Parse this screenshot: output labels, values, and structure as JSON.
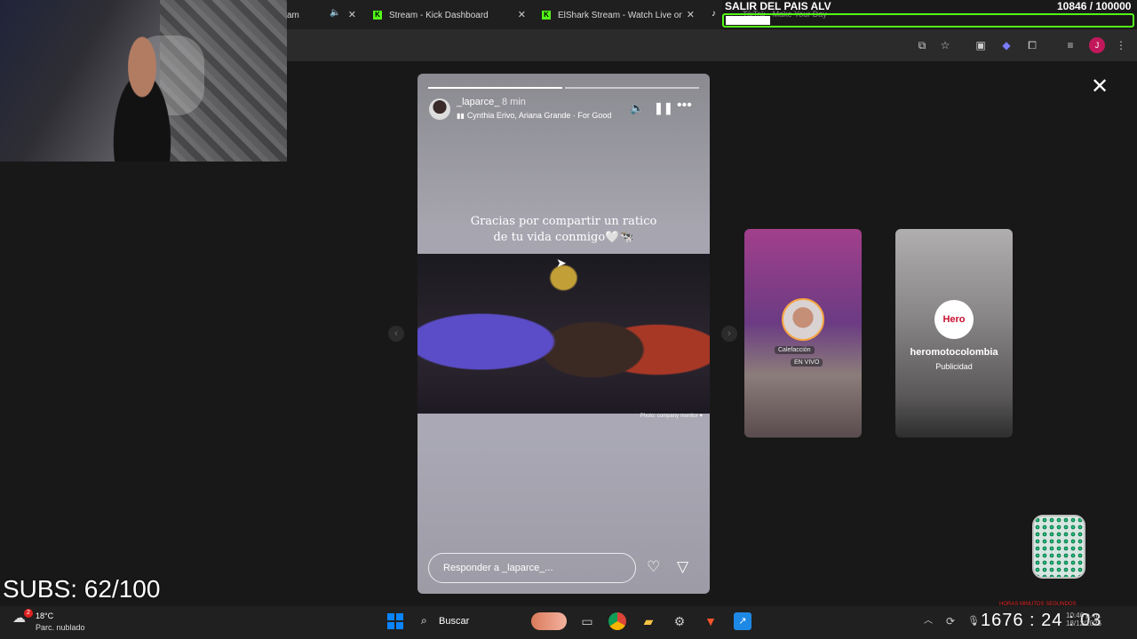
{
  "browser": {
    "tabs": [
      {
        "title": "am",
        "muted": true
      },
      {
        "title": "Stream - Kick Dashboard",
        "favicon": "K"
      },
      {
        "title": "ElShark Stream - Watch Live on",
        "favicon": "K"
      }
    ],
    "toolbar_icons": [
      "cast-icon",
      "star-icon",
      "media-icon",
      "extension-icon",
      "puzzle-icon",
      "reading-list-icon",
      "profile-icon",
      "menu-icon"
    ],
    "profile_initial": "J"
  },
  "goal": {
    "title": "SALIR DEL PAIS ALV",
    "count": "10846  / 100000",
    "ghost_text": "TikTok - Make Your Day",
    "progress_fraction": 0.108,
    "bar_color": "#53fc18"
  },
  "story": {
    "username": "_laparce_",
    "time": "8 min",
    "song": "Cynthia Erivo, Ariana Grande · For Good",
    "caption_line1": "Gracias por compartir un ratico",
    "caption_line2": "de tu vida conmigo🤍🐄",
    "photo_credit": "Photo: company monitor ♥",
    "reply_placeholder": "Responder a _laparce_...",
    "progress_segments": 2,
    "current_segment": 1
  },
  "previews": [
    {
      "tag_line1": "Calefacción",
      "tag_line2": "EN VIVO"
    },
    {
      "name": "heromotocolombia",
      "sub": "Publicidad",
      "logo_text": "Hero"
    }
  ],
  "overlay": {
    "subs": "SUBS: 62/100",
    "timer_labels": "HORAS    MINUTOS    SEGUNDOS",
    "timer": "1676 : 24 : 03"
  },
  "taskbar": {
    "weather_temp": "18°C",
    "weather_condition": "Parc. nublado",
    "weather_badge": "2",
    "search_label": "Buscar",
    "clock": "10:46 p. m.",
    "date": "18/12/2025",
    "tray_lang": "LAA"
  }
}
